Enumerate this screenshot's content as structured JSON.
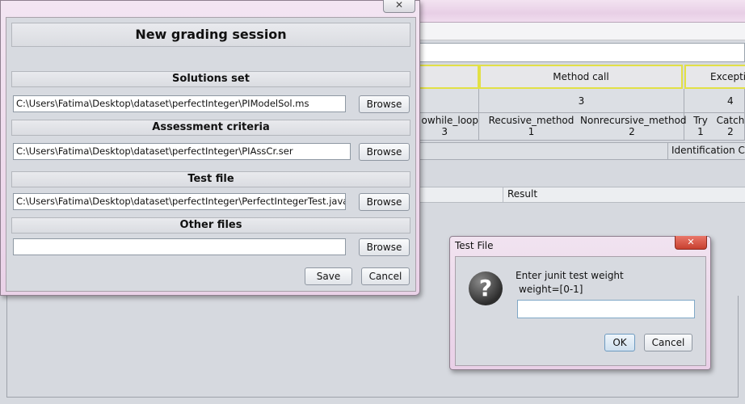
{
  "background": {
    "criteria_headers": [
      "Method call",
      "Exceptio"
    ],
    "criteria_counts": [
      "3",
      "4"
    ],
    "sub_columns": [
      {
        "name": "owhile_loop",
        "count": "3"
      },
      {
        "name": "Recusive_method",
        "count": "1"
      },
      {
        "name": "Nonrecursive_method",
        "count": "2"
      },
      {
        "name": "Try",
        "count": "1"
      },
      {
        "name": "Catch",
        "count": "2"
      }
    ],
    "identification_code_label": "Identification Code",
    "result_label": "Result"
  },
  "session_dialog": {
    "close_glyph": "✕",
    "title": "New grading session",
    "sections": {
      "solutions": {
        "label": "Solutions set",
        "path": "C:\\Users\\Fatima\\Desktop\\dataset\\perfectInteger\\PIModelSol.ms"
      },
      "criteria": {
        "label": "Assessment criteria",
        "path": "C:\\Users\\Fatima\\Desktop\\dataset\\perfectInteger\\PIAssCr.ser"
      },
      "test_file": {
        "label": "Test file",
        "path": "C:\\Users\\Fatima\\Desktop\\dataset\\perfectInteger\\PerfectIntegerTest.java"
      },
      "other": {
        "label": "Other files",
        "path": ""
      }
    },
    "browse_label": "Browse",
    "save_label": "Save",
    "cancel_label": "Cancel"
  },
  "test_dialog": {
    "title": "Test File",
    "close_glyph": "✕",
    "icon_glyph": "?",
    "prompt": "Enter junit test weight",
    "weight_hint": "weight=[0-1]",
    "weight_value": "",
    "ok_label": "OK",
    "cancel_label": "Cancel"
  }
}
